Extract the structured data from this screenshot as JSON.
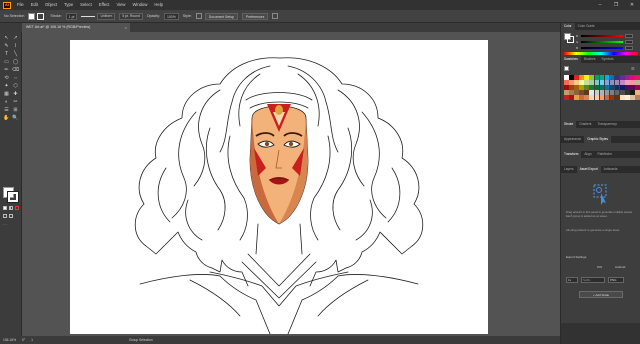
{
  "menubar": {
    "logo": "Ai",
    "items": [
      "File",
      "Edit",
      "Object",
      "Type",
      "Select",
      "Effect",
      "View",
      "Window",
      "Help"
    ],
    "window_buttons": [
      "–",
      "❐",
      "✕"
    ]
  },
  "controlbar": {
    "selection": "No Selection",
    "stroke_label": "Stroke:",
    "stroke_value": "1 pt",
    "profile": "Uniform",
    "brush": "5 pt. Round",
    "opacity_label": "Opacity:",
    "opacity_value": "100%",
    "style_label": "Style:",
    "document_setup": "Document Setup",
    "preferences": "Preferences"
  },
  "tab": {
    "title": "WET Art.ai* @ 106.16 % (RGB/Preview)",
    "close": "×"
  },
  "tools": [
    "↖",
    "↗",
    "✎",
    "⌇",
    "T",
    "╲",
    "▭",
    "◯",
    "✏",
    "⌫",
    "⟲",
    "⇔",
    "✦",
    "⬡",
    "▦",
    "✚",
    "◐",
    "✂",
    "☰",
    "⊞",
    "✋",
    "🔍"
  ],
  "statusbar": {
    "zoom": "106.16%",
    "angle": "0°",
    "artboard": "1",
    "tool": "Group Selection"
  },
  "panels": {
    "color_tabs": [
      "Color",
      "Color Guide"
    ],
    "color_sliders": [
      "R",
      "G",
      "B"
    ],
    "swatch_tabs": [
      "Swatches",
      "Brushes",
      "Symbols"
    ],
    "stroke_tabs": [
      "Stroke",
      "Gradient",
      "Transparency"
    ],
    "appearance_tabs": [
      "Appearance",
      "Graphic Styles"
    ],
    "transform_tabs": [
      "Transform",
      "Align",
      "Pathfinder"
    ],
    "layer_tabs": [
      "Layers",
      "Asset Export",
      "Artboards"
    ],
    "asset_drop_text_1": "Drag artwork to this panel to generate multiple assets. Each group is added as an asset.",
    "asset_drop_text_2": "Alt+drag artwork to generate a single asset.",
    "export_settings": "Export Settings",
    "ios": "iOS",
    "android": "Android",
    "scale": "1x",
    "suffix": "Suffix",
    "format": "PNG",
    "add_scale": "+ Add Scale"
  },
  "colors": {
    "skin": "#f3b27a",
    "skin_shadow": "#c96a3e",
    "red": "#c8201d",
    "lip": "#a31616",
    "gold": "#e1a43c"
  }
}
